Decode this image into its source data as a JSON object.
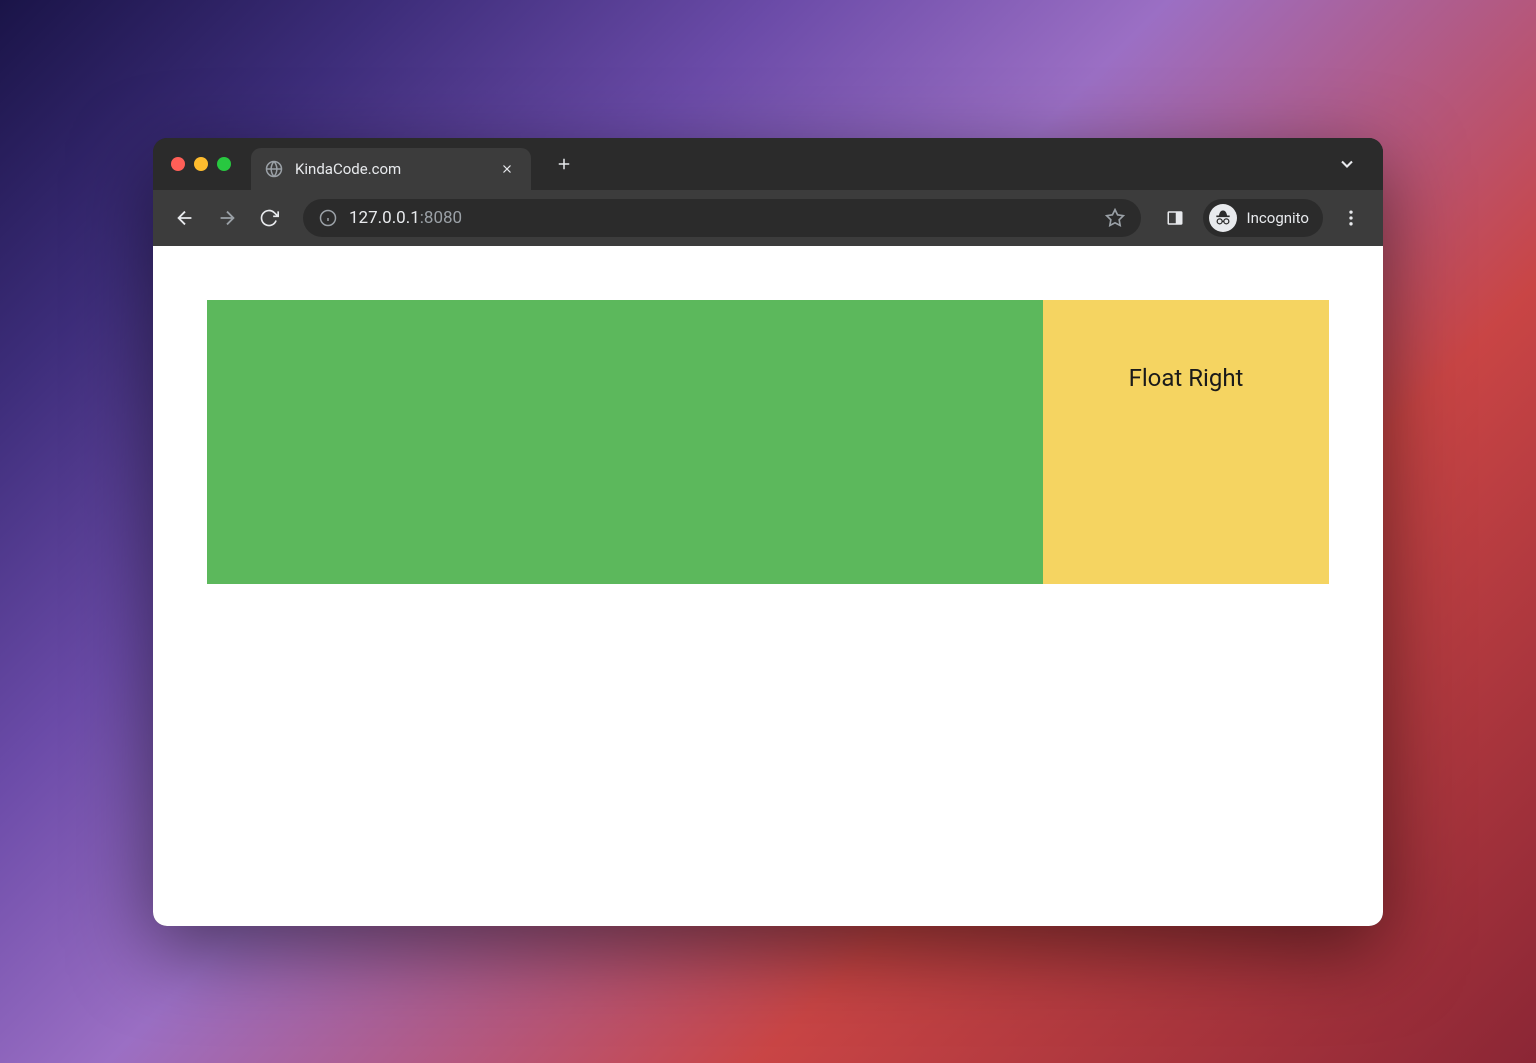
{
  "window": {
    "tab_title": "KindaCode.com",
    "url_host": "127.0.0.1",
    "url_port": ":8080",
    "incognito_label": "Incognito"
  },
  "page": {
    "float_right_text": "Float Right"
  },
  "colors": {
    "green_box": "#5cb85c",
    "yellow_box": "#f5d461"
  }
}
